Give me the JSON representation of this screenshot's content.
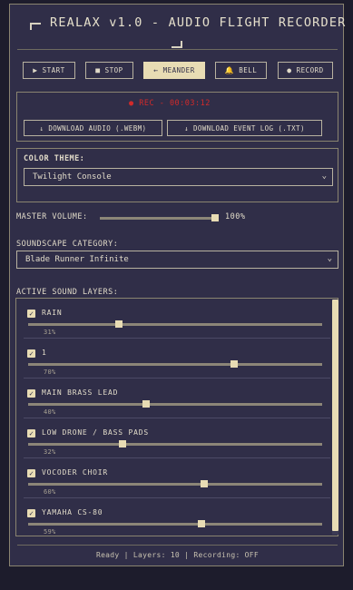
{
  "app": {
    "title": "REALAX v1.0 - AUDIO FLIGHT RECORDER"
  },
  "colors": {
    "panel": "#302e48",
    "accent": "#e8dcb4",
    "record_red": "#d22a2a",
    "border": "#8a8470"
  },
  "toolbar": {
    "start": {
      "label": "START",
      "icon": "play-icon"
    },
    "stop": {
      "label": "STOP",
      "icon": "stop-icon"
    },
    "meander": {
      "label": "MEANDER",
      "icon": "arrow-left-icon"
    },
    "bell": {
      "label": "BELL",
      "icon": "bell-icon"
    },
    "record": {
      "label": "RECORD",
      "icon": "dot-icon"
    }
  },
  "recording": {
    "status": "● REC - 00:03:12",
    "download_audio": "↓ DOWNLOAD AUDIO (.WEBM)",
    "download_log": "↓ DOWNLOAD EVENT LOG (.TXT)"
  },
  "theme": {
    "label": "COLOR THEME:",
    "value": "Twilight Console"
  },
  "volume": {
    "label": "MASTER VOLUME:",
    "value": 100,
    "value_text": "100%"
  },
  "category": {
    "label": "SOUNDSCAPE CATEGORY:",
    "value": "Blade Runner Infinite"
  },
  "layers": {
    "label": "ACTIVE SOUND LAYERS:",
    "items": [
      {
        "name": "RAIN",
        "checked": true,
        "value": 31,
        "value_text": "31%"
      },
      {
        "name": "1",
        "checked": true,
        "value": 70,
        "value_text": "70%"
      },
      {
        "name": "MAIN BRASS LEAD",
        "checked": true,
        "value": 40,
        "value_text": "40%"
      },
      {
        "name": "LOW DRONE / BASS PADS",
        "checked": true,
        "value": 32,
        "value_text": "32%"
      },
      {
        "name": "VOCODER CHOIR",
        "checked": true,
        "value": 60,
        "value_text": "60%"
      },
      {
        "name": "YAMAHA CS-80",
        "checked": true,
        "value": 59,
        "value_text": "59%"
      }
    ]
  },
  "status_bar": {
    "text": "Ready | Layers: 10 | Recording: OFF"
  }
}
